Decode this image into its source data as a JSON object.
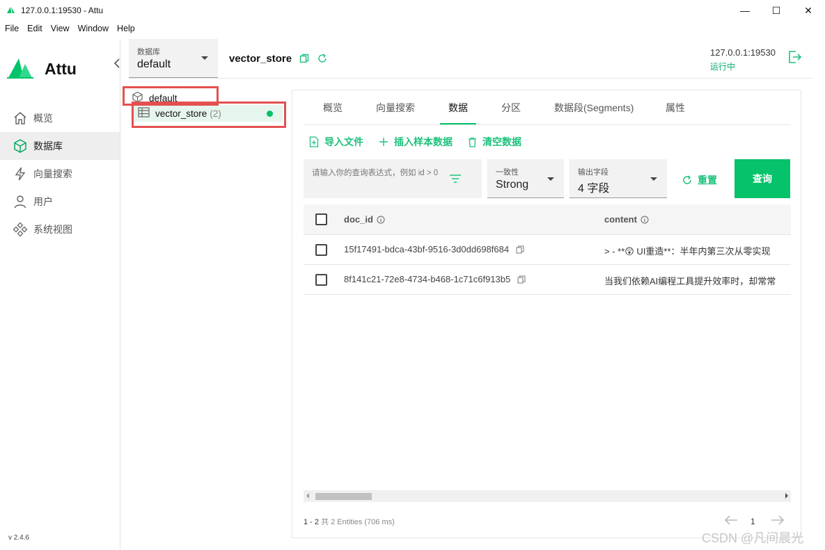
{
  "window": {
    "title": "127.0.0.1:19530 - Attu",
    "minimize_glyph": "—",
    "maximize_glyph": "☐",
    "close_glyph": "✕"
  },
  "menu": [
    "File",
    "Edit",
    "View",
    "Window",
    "Help"
  ],
  "brand": {
    "name": "Attu",
    "version": "v 2.4.6"
  },
  "nav": [
    {
      "label": "概览",
      "icon": "home-icon",
      "active": false
    },
    {
      "label": "数据库",
      "icon": "cube-icon",
      "active": true
    },
    {
      "label": "向量搜索",
      "icon": "lightning-icon",
      "active": false
    },
    {
      "label": "用户",
      "icon": "user-icon",
      "active": false
    },
    {
      "label": "系统视图",
      "icon": "system-view-icon",
      "active": false
    }
  ],
  "header": {
    "db_label": "数据库",
    "db_value": "default",
    "collection": "vector_store",
    "server": "127.0.0.1:19530",
    "status": "运行中"
  },
  "tree": {
    "database": "default",
    "collection": "vector_store",
    "count": "(2)"
  },
  "tabs": [
    "概览",
    "向量搜索",
    "数据",
    "分区",
    "数据段(Segments)",
    "属性"
  ],
  "active_tab": 2,
  "actions": {
    "import": "导入文件",
    "insert": "插入样本数据",
    "clear": "清空数据"
  },
  "query": {
    "placeholder": "请输入你的查询表达式，例如 id > 0",
    "consistency_label": "一致性",
    "consistency_value": "Strong",
    "output_label": "输出字段",
    "output_value": "4 字段",
    "reset": "重置",
    "submit": "查询"
  },
  "table": {
    "columns": [
      "doc_id",
      "content"
    ],
    "rows": [
      {
        "doc_id": "15f17491-bdca-43bf-9516-3d0dd698f684",
        "content": "> - **😲 UI重造**：半年内第三次从零实现"
      },
      {
        "doc_id": "8f141c21-72e8-4734-b468-1c71c6f913b5",
        "content": "当我们依赖AI编程工具提升效率时，却常常"
      }
    ]
  },
  "pagination": {
    "range": "1 - 2",
    "summary": "共 2 Entities (706 ms)",
    "page": "1"
  },
  "watermark": "CSDN @凡间晨光",
  "colors": {
    "accent": "#06c26a",
    "action_text": "#1ec17c",
    "highlight": "#e45050"
  }
}
